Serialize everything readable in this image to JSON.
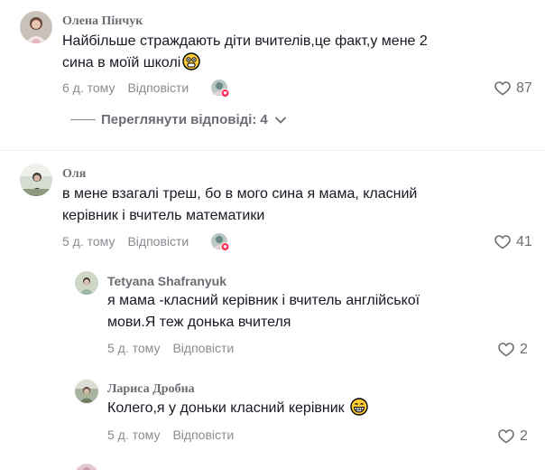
{
  "comments": [
    {
      "author": "Олена Пінчук",
      "text_line1": "Найбільше страждають діти вчителів,це факт,у мене 2",
      "text_line2": "сина в моїй школі",
      "time": "6 д. тому",
      "reply_label": "Відповісти",
      "likes": "87"
    },
    {
      "author": "Оля",
      "text_line1": "в мене взагалі треш, бо в мого сина я мама, класний",
      "text_line2": "керівник і вчитель математики",
      "time": "5 д. тому",
      "reply_label": "Відповісти",
      "likes": "41"
    }
  ],
  "view_replies": {
    "label": "Переглянути відповіді:",
    "count": "4"
  },
  "replies": [
    {
      "author": "Tetyana Shafranyuk",
      "text_line1": "я мама -класний керівник і вчитель англійської",
      "text_line2": "мови.Я теж донька вчителя",
      "time": "5 д. тому",
      "reply_label": "Відповісти",
      "likes": "2"
    },
    {
      "author": "Лариса Дробна",
      "text_line1": "Колего,я у доньки класний керівник",
      "time": "5 д. тому",
      "reply_label": "Відповісти",
      "likes": "2"
    }
  ],
  "colors": {
    "text": "#161823",
    "secondary": "#8a8b91",
    "badge": "#fe2c55"
  }
}
